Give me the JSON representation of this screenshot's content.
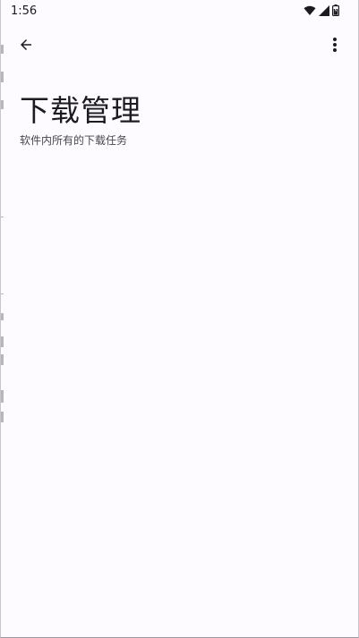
{
  "status_bar": {
    "time": "1:56",
    "icons": [
      "wifi-icon",
      "cell-signal-icon",
      "battery-icon"
    ]
  },
  "app_bar": {
    "back_icon": "arrow-back-icon",
    "menu_icon": "more-vert-icon"
  },
  "page": {
    "title": "下载管理",
    "subtitle": "软件内所有的下载任务"
  },
  "colors": {
    "background": "#fdfbff",
    "text_primary": "#1c1b1f",
    "text_secondary": "#49454f"
  }
}
